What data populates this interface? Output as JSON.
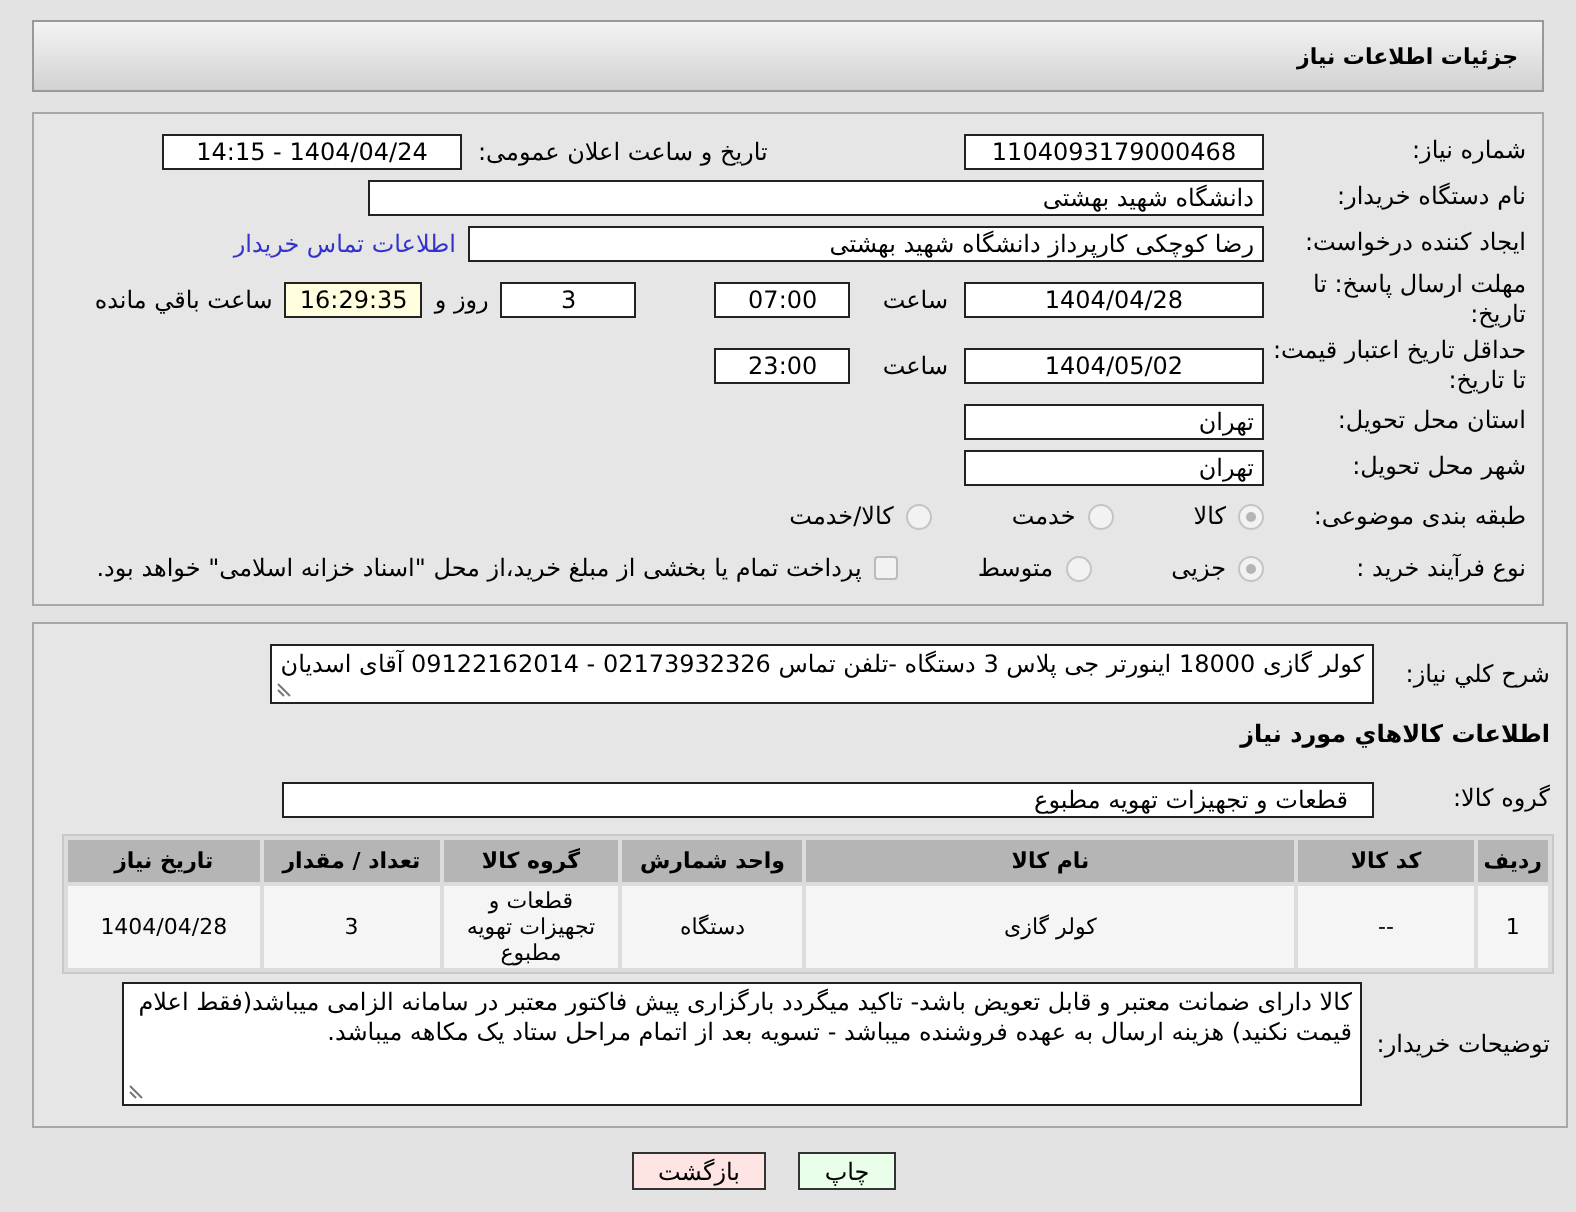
{
  "title": "جزئیات اطلاعات نیاز",
  "need_number": {
    "label": "شماره نیاز:",
    "value": "1104093179000468"
  },
  "announce": {
    "label": "تاریخ و ساعت اعلان عمومی:",
    "value": "1404/04/24 - 14:15"
  },
  "buyer": {
    "label": "نام دستگاه خریدار:",
    "value": "دانشگاه شهید بهشتی"
  },
  "creator": {
    "label": "ایجاد کننده درخواست:",
    "value": "رضا کوچکی کارپرداز دانشگاه شهید بهشتی",
    "link": "اطلاعات تماس خریدار"
  },
  "deadline": {
    "label": "مهلت ارسال پاسخ: تا تاریخ:",
    "date": "1404/04/28",
    "time_label": "ساعت",
    "time": "07:00",
    "days": "3",
    "days_label": "روز و",
    "remaining": "16:29:35",
    "remaining_label": "ساعت باقي مانده"
  },
  "validity": {
    "label": "حداقل تاریخ اعتبار قیمت: تا تاریخ:",
    "date": "1404/05/02",
    "time_label": "ساعت",
    "time": "23:00"
  },
  "province": {
    "label": "استان محل تحویل:",
    "value": "تهران"
  },
  "city": {
    "label": "شهر محل تحویل:",
    "value": "تهران"
  },
  "category": {
    "label": "طبقه بندی موضوعی:",
    "options": [
      {
        "label": "کالا",
        "selected": true
      },
      {
        "label": "خدمت",
        "selected": false
      },
      {
        "label": "کالا/خدمت",
        "selected": false
      }
    ]
  },
  "process": {
    "label": "نوع فرآیند خرید :",
    "options": [
      {
        "label": "جزیی",
        "selected": true
      },
      {
        "label": "متوسط",
        "selected": false
      }
    ],
    "payment": {
      "label": "پرداخت تمام یا بخشی از مبلغ خرید،از محل \"اسناد خزانه اسلامی\" خواهد بود.",
      "checked": false
    }
  },
  "description": {
    "label": "شرح کلي نیاز:",
    "value": "کولر گازی  18000 اینورتر جی پلاس 3 دستگاه -تلفن تماس 02173932326 - 09122162014 آقای اسدیان"
  },
  "goods_title": "اطلاعات کالاهاي مورد نياز",
  "goods_group": {
    "label": "گروه کالا:",
    "value": "قطعات و تجهیزات تهویه مطبوع"
  },
  "table": {
    "columns": [
      "ردیف",
      "کد کالا",
      "نام کالا",
      "واحد شمارش",
      "گروه کالا",
      "تعداد / مقدار",
      "تاریخ نیاز"
    ],
    "rows": [
      [
        "1",
        "--",
        "کولر گازی",
        "دستگاه",
        "قطعات و تجهیزات تهویه مطبوع",
        "3",
        "1404/04/28"
      ]
    ]
  },
  "buyer_notes": {
    "label": "توضیحات خریدار:",
    "value": "کالا دارای ضمانت معتبر و قابل تعویض باشد- تاکید میگردد بارگزاری پیش فاکتور معتبر در سامانه الزامی میباشد(فقط اعلام قیمت نکنید) هزینه ارسال به عهده فروشنده میباشد - تسویه بعد از اتمام مراحل ستاد یک مکاهه میباشد."
  },
  "buttons": [
    {
      "label": "چاپ",
      "kind": "print"
    },
    {
      "label": "بازگشت",
      "kind": "back"
    }
  ]
}
